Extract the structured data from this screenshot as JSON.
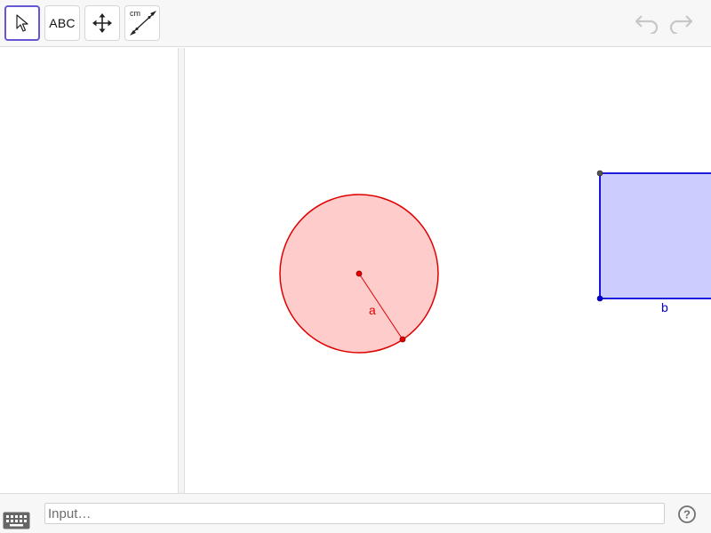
{
  "toolbar": {
    "tools": [
      {
        "name": "move",
        "icon": "cursor-arrow-icon",
        "selected": true
      },
      {
        "name": "text",
        "label": "ABC",
        "icon": "text-tool-icon"
      },
      {
        "name": "move-graphics-view",
        "icon": "move-arrows-icon"
      },
      {
        "name": "distance",
        "label": "cm",
        "icon": "distance-tool-icon"
      }
    ],
    "undo_icon": "undo-icon",
    "redo_icon": "redo-icon",
    "accent": "#6557d2"
  },
  "graphics": {
    "circle": {
      "label": "a",
      "fill": "#ffcccc",
      "stroke": "#e00000"
    },
    "square": {
      "label": "b",
      "fill": "#ccccff",
      "stroke": "#0000d9"
    }
  },
  "input_bar": {
    "placeholder": "Input…",
    "keyboard_icon": "keyboard-icon",
    "help_icon": "help-icon"
  }
}
